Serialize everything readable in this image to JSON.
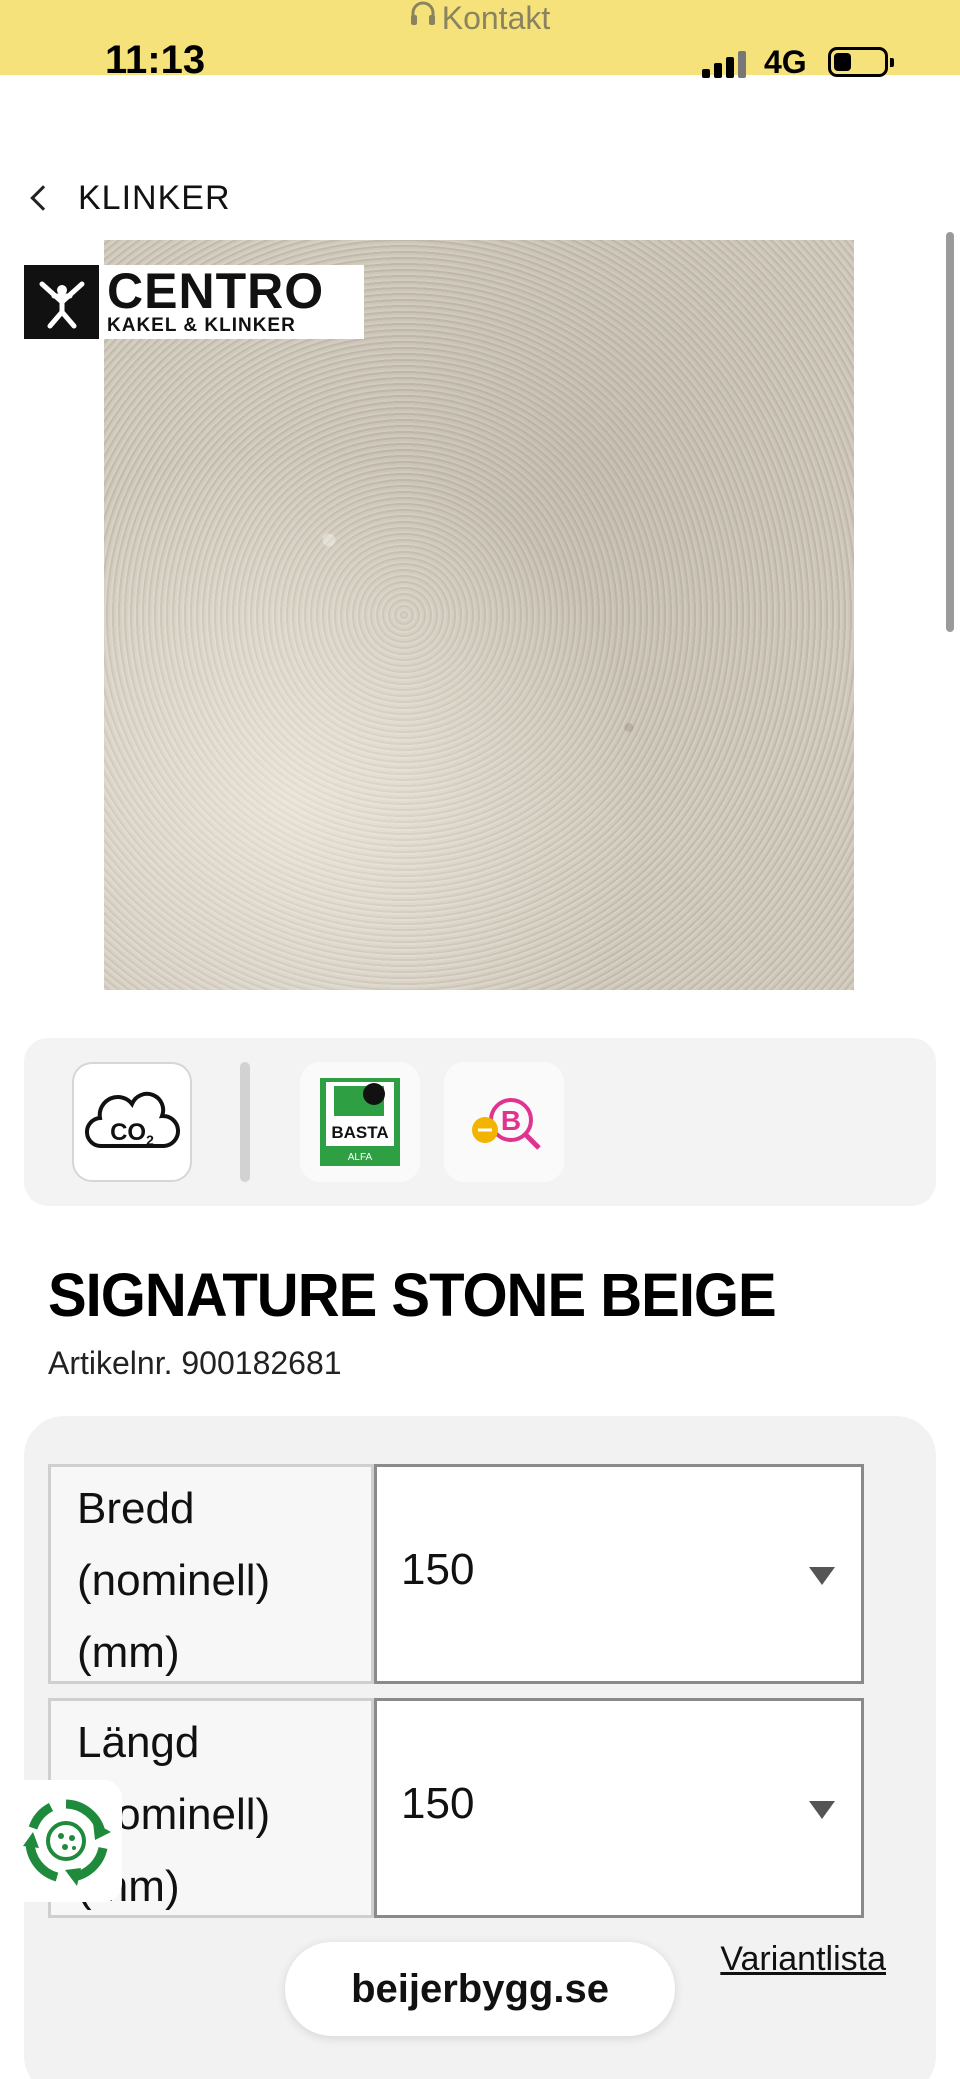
{
  "status_bar": {
    "contact_label": "Kontakt",
    "time": "11:13",
    "network": "4G"
  },
  "nav": {
    "back_label": "KLINKER"
  },
  "brand": {
    "name": "CENTRO",
    "tagline": "KAKEL & KLINKER"
  },
  "certifications": {
    "co2_label": "CO2",
    "basta_label": "BASTA",
    "basta_sublabel": "ALFA",
    "b_label": "B"
  },
  "product": {
    "title": "SIGNATURE STONE BEIGE",
    "article": "Artikelnr. 900182681"
  },
  "variants": [
    {
      "label_lines": [
        "Bredd",
        "(nominell)",
        "(mm)"
      ],
      "value": "150"
    },
    {
      "label_lines": [
        "Längd",
        "(nominell)",
        "(mm)"
      ],
      "value": "150"
    }
  ],
  "variant_list_link": "Variantlista",
  "browser": {
    "url": "beijerbygg.se"
  },
  "colors": {
    "status_bar_bg": "#f6e27a",
    "basta_green": "#2ea043",
    "b_magenta": "#e0338f",
    "b_yellow": "#f2b400",
    "recycle_green": "#1f8a3c"
  }
}
